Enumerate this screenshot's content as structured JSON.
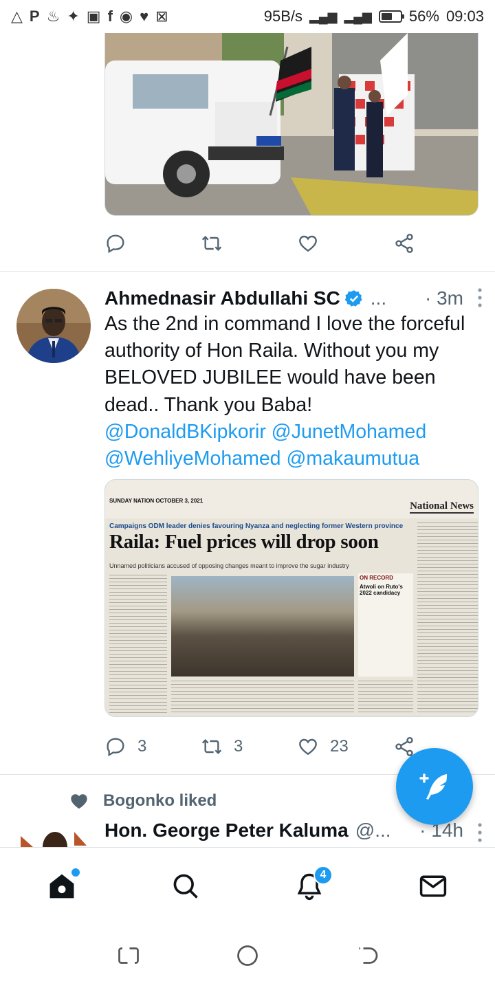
{
  "status_bar": {
    "left_icons": [
      "drive-icon",
      "pocket-icon",
      "tinder-icon",
      "twitter-icon",
      "gallery-icon",
      "facebook-icon",
      "chat-icon",
      "heart-icon",
      "image-icon"
    ],
    "net_speed": "95B/s",
    "battery": "56%",
    "battery_level": 0.56,
    "time": "09:03"
  },
  "tweet1": {
    "image_description_icon": "photo-flag-off-icon",
    "actions": {
      "reply_count": "",
      "retweet_count": "",
      "like_count": ""
    }
  },
  "tweet2": {
    "author_name": "Ahmednasir Abdullahi SC",
    "handle": "...",
    "time": "· 3m",
    "text_plain": "As the 2nd in command I love the forceful authority of Hon Raila. Without you my BELOVED JUBILEE would have been dead.. Thank you Baba!",
    "mentions": [
      "@DonaldBKipkorir",
      "@JunetMohamed",
      "@WehliyeMohamed",
      "@makaumutua"
    ],
    "newspaper": {
      "kicker": "SUNDAY NATION OCTOBER 3, 2021",
      "section": "National News",
      "campaign_line": "Campaigns ODM leader denies favouring Nyanza and neglecting former Western province",
      "headline": "Raila: Fuel prices will drop soon",
      "subhead": "Unnamed politicians accused of opposing changes meant to improve the sugar industry",
      "box_title": "ON RECORD",
      "box_head": "Atwoli on Ruto's 2022 candidacy"
    },
    "actions": {
      "reply_count": "3",
      "retweet_count": "3",
      "like_count": "23"
    }
  },
  "liked": {
    "label": "Bogonko liked"
  },
  "tweet3": {
    "author_name": "Hon. George Peter Kaluma",
    "handle": "@...",
    "time": "· 14h"
  },
  "colors": {
    "accent": "#1d9bf0",
    "text_primary": "#0f1419",
    "text_secondary": "#536471"
  },
  "bottom_nav": {
    "notifications_badge": "4"
  }
}
